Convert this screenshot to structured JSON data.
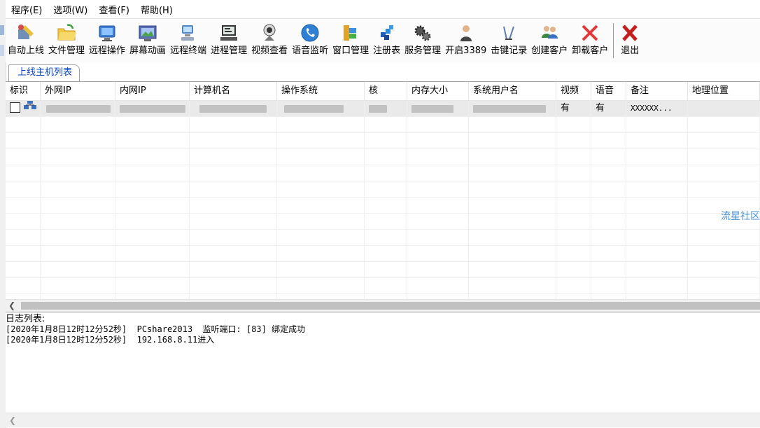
{
  "menu": [
    "程序(E)",
    "选项(W)",
    "查看(F)",
    "帮助(H)"
  ],
  "toolbar": [
    {
      "label": "自动上线",
      "icon": "auto-online-icon"
    },
    {
      "label": "文件管理",
      "icon": "folder-icon"
    },
    {
      "label": "远程操作",
      "icon": "monitor-icon"
    },
    {
      "label": "屏幕动画",
      "icon": "screen-icon"
    },
    {
      "label": "远程终端",
      "icon": "terminal-icon"
    },
    {
      "label": "进程管理",
      "icon": "computer-icon"
    },
    {
      "label": "视频查看",
      "icon": "webcam-icon"
    },
    {
      "label": "语音监听",
      "icon": "phone-icon"
    },
    {
      "label": "窗口管理",
      "icon": "windows-icon"
    },
    {
      "label": "注册表",
      "icon": "registry-icon"
    },
    {
      "label": "服务管理",
      "icon": "gears-icon"
    },
    {
      "label": "开启3389",
      "icon": "user-icon"
    },
    {
      "label": "击键记录",
      "icon": "keylog-icon"
    },
    {
      "label": "创建客户",
      "icon": "users-icon"
    },
    {
      "label": "卸载客户",
      "icon": "delete-icon"
    },
    {
      "label": "退出",
      "icon": "exit-icon"
    }
  ],
  "tab_label": "上线主机列表",
  "columns": [
    "标识",
    "外网IP",
    "内网IP",
    "计算机名",
    "操作系统",
    "核",
    "内存大小",
    "系统用户名",
    "视频",
    "语音",
    "备注",
    "地理位置"
  ],
  "rows": [
    {
      "video": "有",
      "audio": "有",
      "remark": "XXXXXX..."
    }
  ],
  "watermark": "流星社区",
  "log": {
    "title": "日志列表:",
    "lines": [
      "[2020年1月8日12时12分52秒]  PCshare2013  监听端口: [83] 绑定成功",
      "[2020年1月8日12时12分52秒]  192.168.8.11进入"
    ]
  }
}
